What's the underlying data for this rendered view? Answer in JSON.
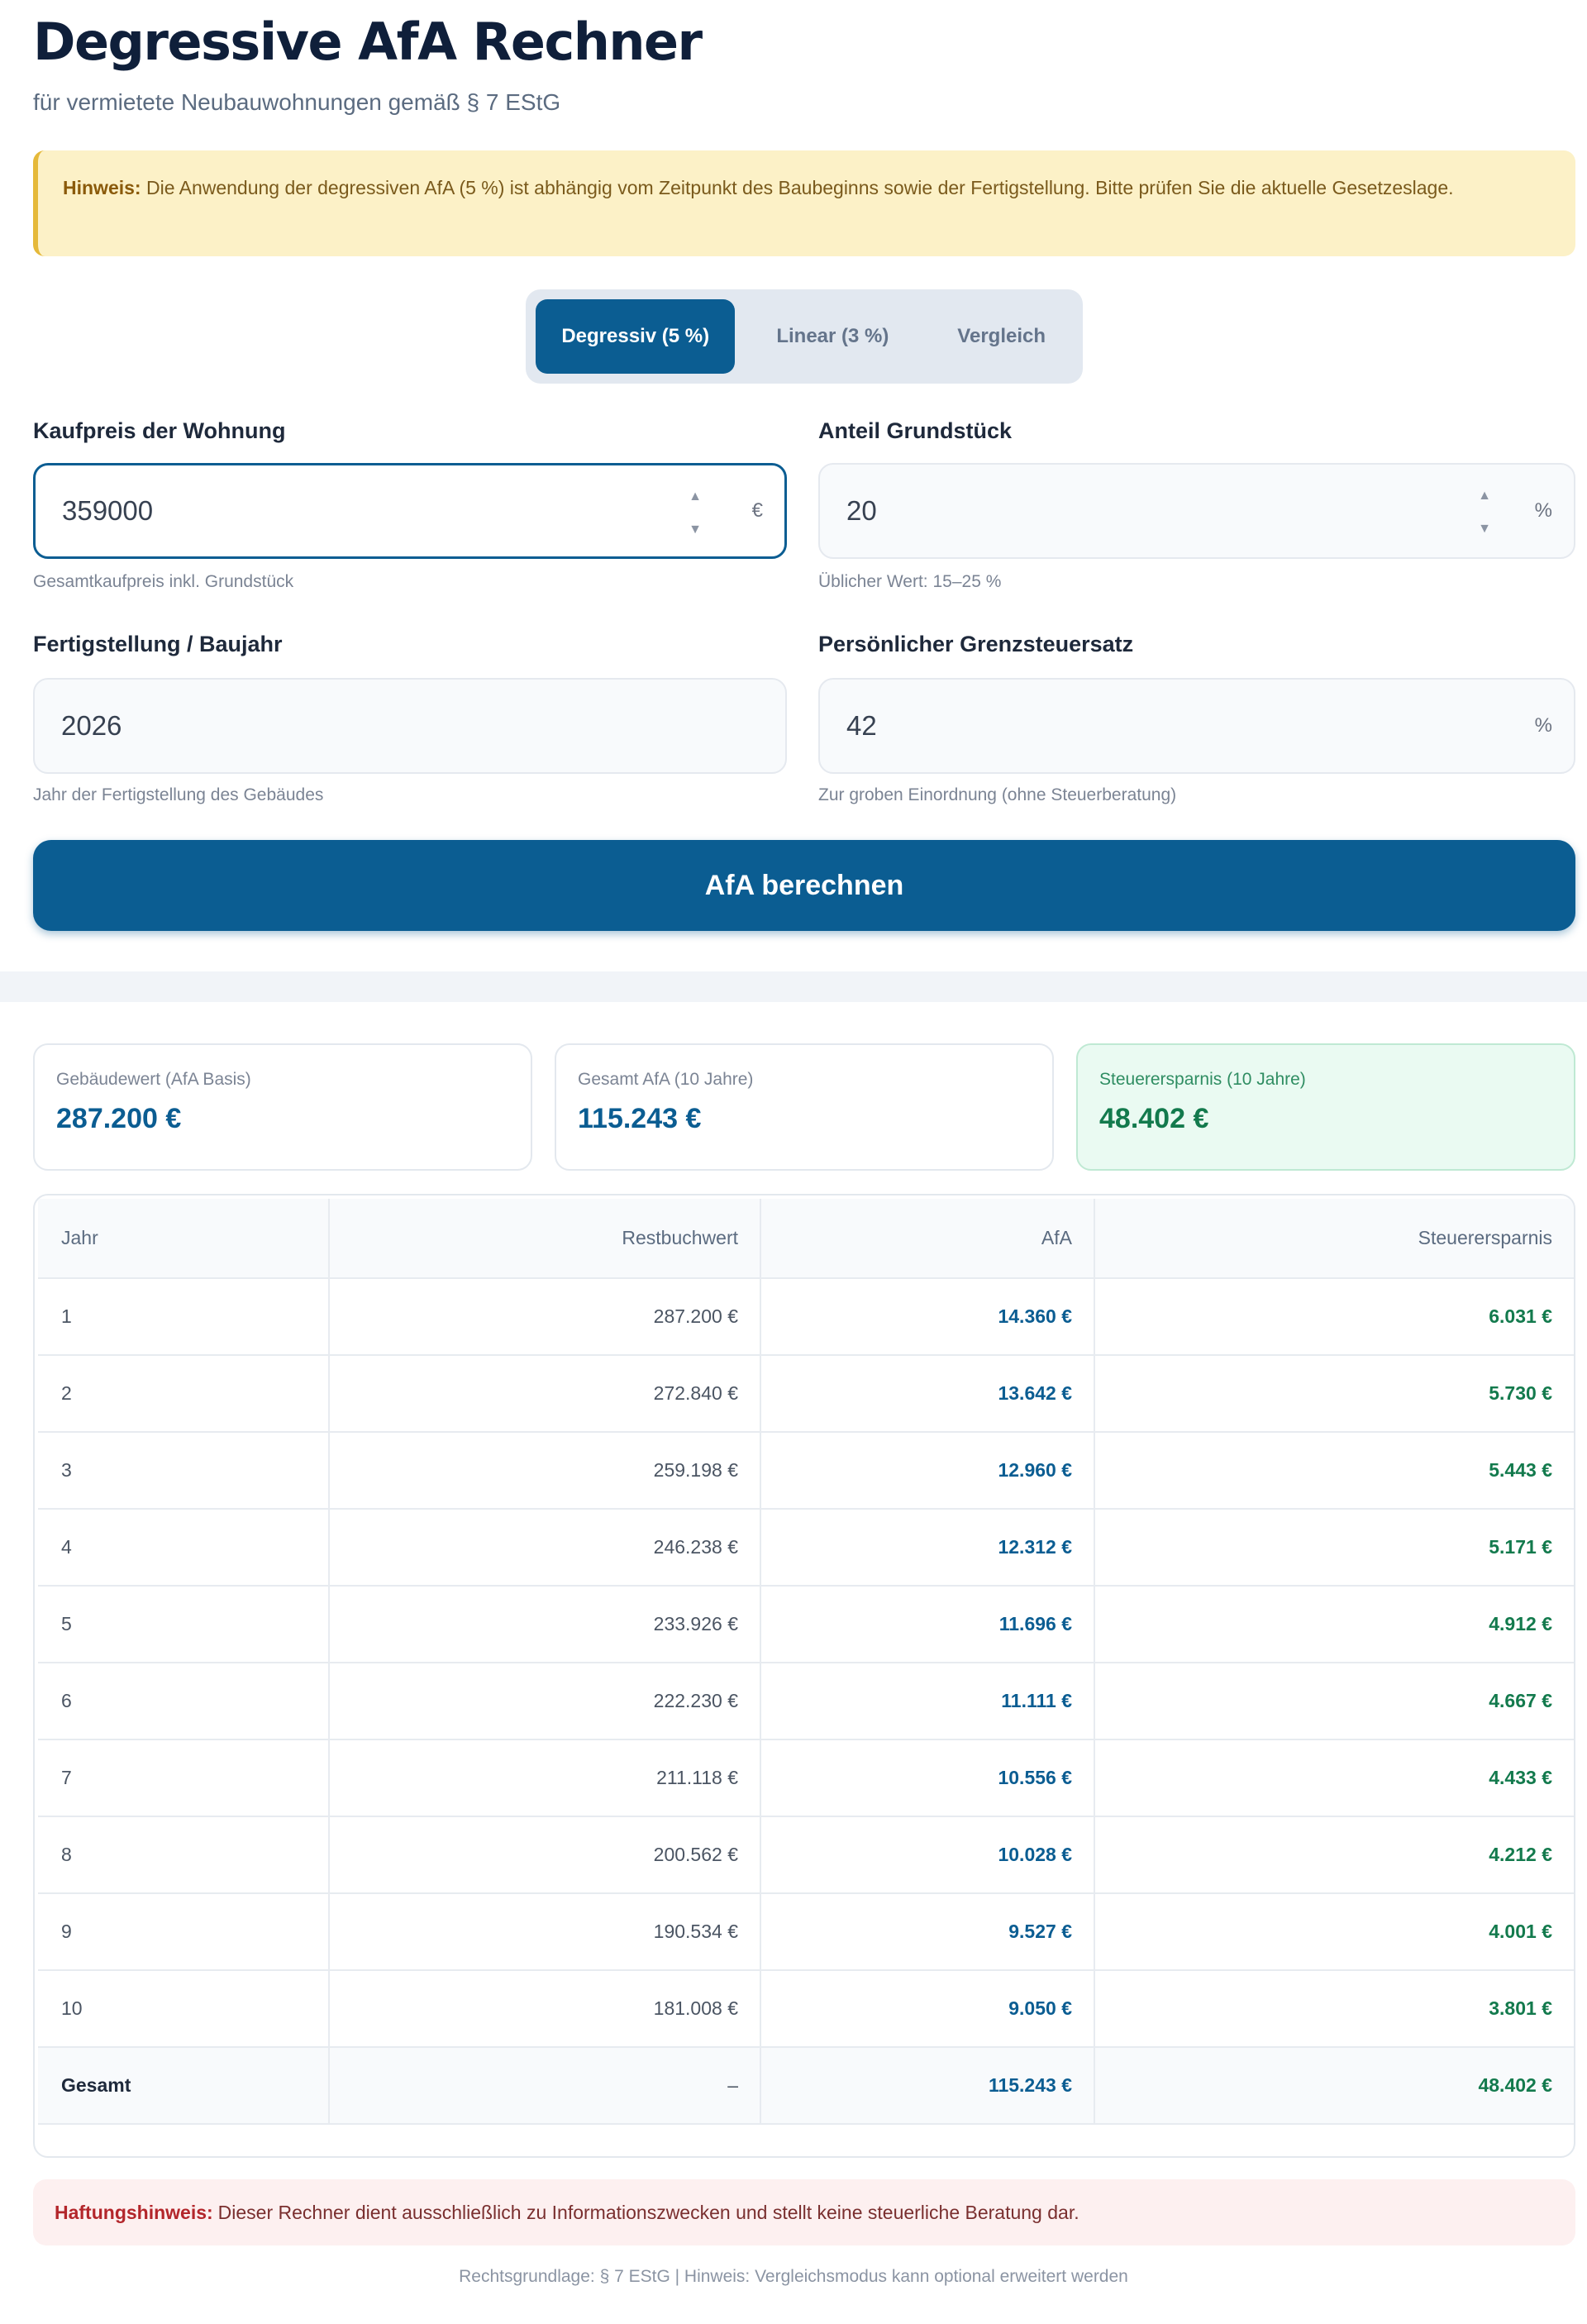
{
  "header": {
    "title": "Degressive AfA Rechner",
    "subtitle": "für vermietete Neubauwohnungen gemäß § 7 EStG"
  },
  "notice": {
    "label": "Hinweis:",
    "text": "Die Anwendung der degressiven AfA (5 %) ist abhängig vom Zeitpunkt des Baubeginns sowie der Fertigstellung. Bitte prüfen Sie die aktuelle Gesetzeslage."
  },
  "tabs": [
    {
      "label": "Degressiv (5 %)",
      "active": true
    },
    {
      "label": "Linear (3 %)",
      "active": false
    },
    {
      "label": "Vergleich",
      "active": false
    }
  ],
  "form": {
    "kaufpreis": {
      "label": "Kaufpreis der Wohnung",
      "value": "359000",
      "unit": "€",
      "hint": "Gesamtkaufpreis inkl. Grundstück"
    },
    "grundstueck": {
      "label": "Anteil Grundstück",
      "value": "20",
      "unit": "%",
      "hint": "Üblicher Wert: 15–25 %"
    },
    "baujahr": {
      "label": "Fertigstellung / Baujahr",
      "value": "2026",
      "hint": "Jahr der Fertigstellung des Gebäudes"
    },
    "steuersatz": {
      "label": "Persönlicher Grenzsteuersatz",
      "value": "42",
      "unit": "%",
      "hint": "Zur groben Einordnung (ohne Steuerberatung)"
    },
    "submit_label": "AfA berechnen"
  },
  "kpis": [
    {
      "label": "Gebäudewert (AfA Basis)",
      "value": "287.200 €"
    },
    {
      "label": "Gesamt AfA (10 Jahre)",
      "value": "115.243 €"
    },
    {
      "label": "Steuerersparnis (10 Jahre)",
      "value": "48.402 €"
    }
  ],
  "table": {
    "columns": [
      "Jahr",
      "Restbuchwert",
      "AfA",
      "Steuerersparnis"
    ],
    "rows": [
      [
        "1",
        "287.200 €",
        "14.360 €",
        "6.031 €"
      ],
      [
        "2",
        "272.840 €",
        "13.642 €",
        "5.730 €"
      ],
      [
        "3",
        "259.198 €",
        "12.960 €",
        "5.443 €"
      ],
      [
        "4",
        "246.238 €",
        "12.312 €",
        "5.171 €"
      ],
      [
        "5",
        "233.926 €",
        "11.696 €",
        "4.912 €"
      ],
      [
        "6",
        "222.230 €",
        "11.111 €",
        "4.667 €"
      ],
      [
        "7",
        "211.118 €",
        "10.556 €",
        "4.433 €"
      ],
      [
        "8",
        "200.562 €",
        "10.028 €",
        "4.212 €"
      ],
      [
        "9",
        "190.534 €",
        "9.527 €",
        "4.001 €"
      ],
      [
        "10",
        "181.008 €",
        "9.050 €",
        "3.801 €"
      ]
    ],
    "total": [
      "Gesamt",
      "–",
      "115.243 €",
      "48.402 €"
    ]
  },
  "disclaimer": {
    "label": "Haftungshinweis:",
    "text": "Dieser Rechner dient ausschließlich zu Informationszwecken und stellt keine steuerliche Beratung dar."
  },
  "footer": "Rechtsgrundlage: § 7 EStG | Hinweis: Vergleichsmodus kann optional erweitert werden"
}
